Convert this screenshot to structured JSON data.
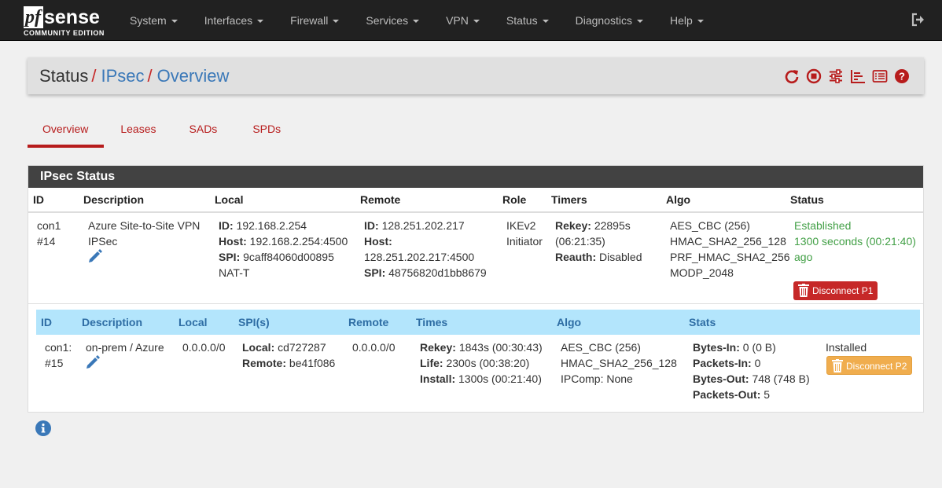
{
  "brand": {
    "logo_pf": "pf",
    "logo_sense": "sense",
    "edition": "COMMUNITY EDITION"
  },
  "nav": {
    "items": [
      "System",
      "Interfaces",
      "Firewall",
      "Services",
      "VPN",
      "Status",
      "Diagnostics",
      "Help"
    ],
    "logout_icon": "sign-out-icon"
  },
  "breadcrumb": {
    "part1": "Status",
    "part2": "IPsec",
    "part3": "Overview",
    "separator": "/"
  },
  "toolbar_icons": [
    "refresh-icon",
    "stop-icon",
    "sliders-icon",
    "chart-icon",
    "list-icon",
    "help-icon"
  ],
  "tabs": [
    "Overview",
    "Leases",
    "SADs",
    "SPDs"
  ],
  "panel": {
    "title": "IPsec Status",
    "p1_headers": {
      "id": "ID",
      "description": "Description",
      "local": "Local",
      "remote": "Remote",
      "role": "Role",
      "timers": "Timers",
      "algo": "Algo",
      "status": "Status"
    },
    "p1": {
      "id1": "con1",
      "id2": "#14",
      "desc1": "Azure Site-to-Site VPN",
      "desc2": "IPSec",
      "local_id_label": "ID:",
      "local_id": "192.168.2.254",
      "local_host_label": "Host:",
      "local_host": "192.168.2.254:4500",
      "local_spi_label": "SPI:",
      "local_spi": "9caff84060d00895",
      "local_natt": "NAT-T",
      "remote_id_label": "ID:",
      "remote_id": "128.251.202.217",
      "remote_host_label": "Host:",
      "remote_host": "128.251.202.217:4500",
      "remote_spi_label": "SPI:",
      "remote_spi": "48756820d1bb8679",
      "role1": "IKEv2",
      "role2": "Initiator",
      "rekey_label": "Rekey:",
      "rekey": "22895s",
      "rekey2": "(06:21:35)",
      "reauth_label": "Reauth:",
      "reauth": "Disabled",
      "algo": [
        "AES_CBC (256)",
        "HMAC_SHA2_256_128",
        "PRF_HMAC_SHA2_256",
        "MODP_2048"
      ],
      "status1": "Established",
      "status2": "1300 seconds (00:21:40)",
      "status3": "ago",
      "disconnect": "Disconnect P1"
    },
    "p2_headers": {
      "id": "ID",
      "description": "Description",
      "local": "Local",
      "spis": "SPI(s)",
      "remote": "Remote",
      "times": "Times",
      "algo": "Algo",
      "stats": "Stats"
    },
    "p2": {
      "id1": "con1:",
      "id2": "#15",
      "desc": "on-prem / Azure",
      "local": "0.0.0.0/0",
      "spi_local_label": "Local:",
      "spi_local": "cd727287",
      "spi_remote_label": "Remote:",
      "spi_remote": "be41f086",
      "remote": "0.0.0.0/0",
      "rekey_label": "Rekey:",
      "rekey": "1843s (00:30:43)",
      "life_label": "Life:",
      "life": "2300s (00:38:20)",
      "install_label": "Install:",
      "install": "1300s (00:21:40)",
      "algo": [
        "AES_CBC (256)",
        "HMAC_SHA2_256_128",
        "IPComp: None"
      ],
      "bytes_in_label": "Bytes-In:",
      "bytes_in": "0 (0 B)",
      "packets_in_label": "Packets-In:",
      "packets_in": "0",
      "bytes_out_label": "Bytes-Out:",
      "bytes_out": "748 (748 B)",
      "packets_out_label": "Packets-Out:",
      "packets_out": "5",
      "state": "Installed",
      "disconnect": "Disconnect P2"
    }
  },
  "colors": {
    "accent_red": "#b71c1c",
    "link_blue": "#3a78b8",
    "nav_bg": "#212121",
    "status_green": "#43a047",
    "p2_header_bg": "#b3e5fc",
    "warning_orange": "#f0ad4e"
  }
}
